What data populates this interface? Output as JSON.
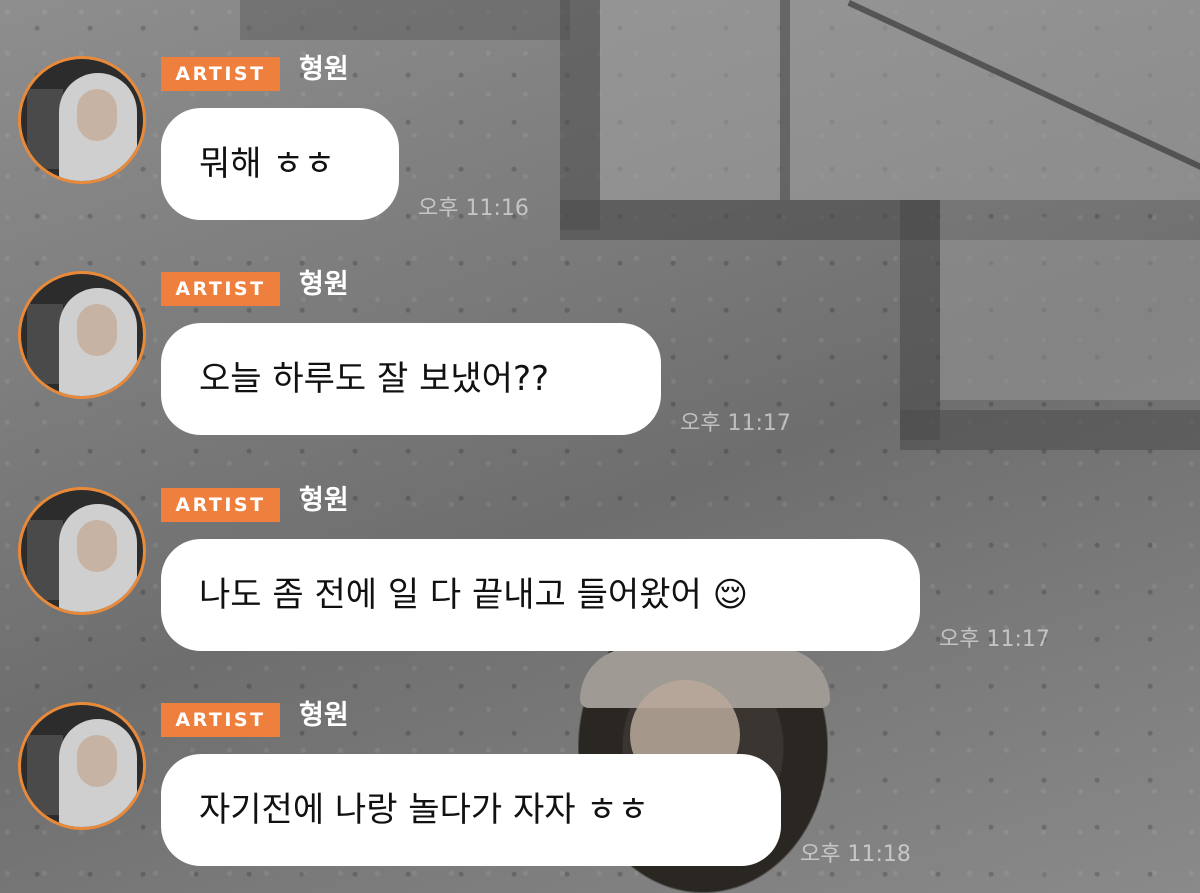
{
  "messages": [
    {
      "badge": "ARTIST",
      "name": "형원",
      "text": "뭐해 ㅎㅎ",
      "time": "오후 11:16"
    },
    {
      "badge": "ARTIST",
      "name": "형원",
      "text": "오늘 하루도 잘 보냈어??",
      "time": "오후 11:17"
    },
    {
      "badge": "ARTIST",
      "name": "형원",
      "text": "나도 좀 전에 일 다 끝내고 들어왔어 😌",
      "time": "오후 11:17"
    },
    {
      "badge": "ARTIST",
      "name": "형원",
      "text": "자기전에 나랑 놀다가 자자 ㅎㅎ",
      "time": "오후 11:18"
    }
  ],
  "colors": {
    "badge": "#ee7f3c",
    "avatar_ring": "#e98a3a",
    "bubble": "#ffffff"
  },
  "icons": {
    "avatar": "profile-photo"
  }
}
